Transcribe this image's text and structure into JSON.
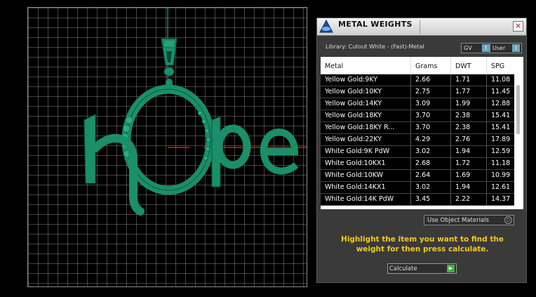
{
  "viewport": {
    "pendant_text": "hOpe",
    "colors": {
      "metal": "#1a8f6a",
      "axis_x": "#ff2020",
      "axis_y": "#16a0a0",
      "grid": "#9a9a9a"
    }
  },
  "panel": {
    "title": "METAL WEIGHTS",
    "close_glyph": "×",
    "library": "Library: Cutout White - (Fast)-Metal",
    "gv_label": "GV",
    "user_label": "User",
    "toggle_glyph": "I",
    "columns": [
      "Metal",
      "Grams",
      "DWT",
      "SPG"
    ],
    "rows": [
      {
        "metal": "Yellow Gold:9KY",
        "grams": "2.66",
        "dwt": "1.71",
        "spg": "11.08"
      },
      {
        "metal": "Yellow Gold:10KY",
        "grams": "2.75",
        "dwt": "1.77",
        "spg": "11.45"
      },
      {
        "metal": "Yellow Gold:14KY",
        "grams": "3.09",
        "dwt": "1.99",
        "spg": "12.88"
      },
      {
        "metal": "Yellow Gold:18KY",
        "grams": "3.70",
        "dwt": "2.38",
        "spg": "15.41"
      },
      {
        "metal": "Yellow Gold:18KY R...",
        "grams": "3.70",
        "dwt": "2.38",
        "spg": "15.41"
      },
      {
        "metal": "Yellow Gold:22KY",
        "grams": "4.29",
        "dwt": "2.76",
        "spg": "17.89"
      },
      {
        "metal": "White Gold:9K PdW",
        "grams": "3.02",
        "dwt": "1.94",
        "spg": "12.59"
      },
      {
        "metal": "White Gold:10KX1",
        "grams": "2.68",
        "dwt": "1.72",
        "spg": "11.18"
      },
      {
        "metal": "White Gold:10KW",
        "grams": "2.64",
        "dwt": "1.69",
        "spg": "10.99"
      },
      {
        "metal": "White Gold:14KX1",
        "grams": "3.02",
        "dwt": "1.94",
        "spg": "12.61"
      },
      {
        "metal": "White Gold:14K PdW",
        "grams": "3.45",
        "dwt": "2.22",
        "spg": "14.37"
      }
    ],
    "use_object_materials": "Use Object Materials",
    "dropdown_glyph": "○",
    "instructions": "Highlight the item you want to find the weight for then press calculate.",
    "calculate_label": "Calculate",
    "play_glyph": "▶"
  }
}
